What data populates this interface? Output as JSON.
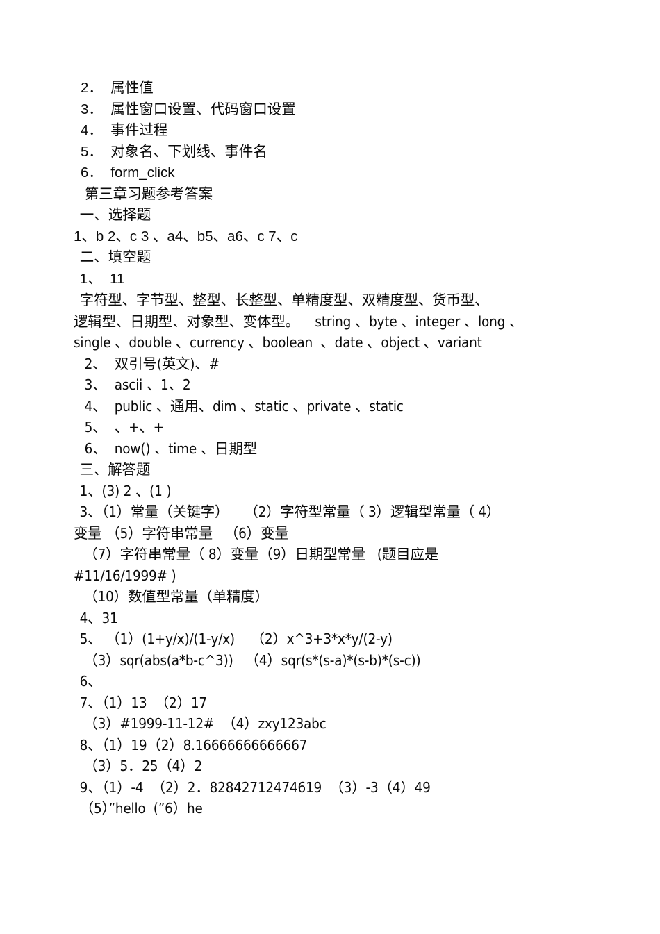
{
  "document": {
    "background_color": "#ffffff",
    "text_color": "#0a0a0a",
    "lines": [
      {
        "id": "l01",
        "text": "2．  属性值"
      },
      {
        "id": "l02",
        "text": "3．  属性窗口设置、代码窗口设置"
      },
      {
        "id": "l03",
        "text": "4．  事件过程"
      },
      {
        "id": "l04",
        "text": "5．  对象名、下划线、事件名"
      },
      {
        "id": "l05",
        "text": "6．  form_click"
      },
      {
        "id": "l06",
        "text": " 第三章习题参考答案"
      },
      {
        "id": "l07",
        "text": " 一、选择题"
      },
      {
        "id": "l08",
        "text": "1、b 2、c 3 、a4、b5、a6、c 7、c"
      },
      {
        "id": "l09",
        "text": " 二、填空题"
      },
      {
        "id": "l10",
        "text": " 1、  11"
      },
      {
        "id": "l11",
        "text": " 字符型、字节型、整型、长整型、单精度型、双精度型、货币型、"
      },
      {
        "id": "l12",
        "text": "逻辑型、日期型、对象型、变体型。    string 、byte 、integer 、long 、"
      },
      {
        "id": "l13",
        "text": "single 、double 、currency 、boolean  、date 、object 、variant"
      },
      {
        "id": "l14",
        "text": " 2、  双引号(英文)、#"
      },
      {
        "id": "l15",
        "text": " 3、  ascii 、1、2"
      },
      {
        "id": "l16",
        "text": " 4、  public 、通用、dim 、static 、private 、static"
      },
      {
        "id": "l17",
        "text": " 5、  、+、+"
      },
      {
        "id": "l18",
        "text": " 6、  now() 、time 、日期型"
      },
      {
        "id": "l19",
        "text": " 三、解答题"
      },
      {
        "id": "l20",
        "text": " 1、(3) 2 、(1 )"
      },
      {
        "id": "l21",
        "text": " 3、（1）常量（关键字）    （2）字符型常量（ 3）逻辑型常量（ 4）"
      },
      {
        "id": "l22",
        "text": "变量 （5）字符串常量   （6）变量"
      },
      {
        "id": "l23",
        "text": "  （7）字符串常量（ 8）变量（9）日期型常量   (题目应是"
      },
      {
        "id": "l24",
        "text": "#11/16/1999# )"
      },
      {
        "id": "l25",
        "text": "  （10）数值型常量（单精度）"
      },
      {
        "id": "l26",
        "text": " 4、31"
      },
      {
        "id": "l27",
        "text": " 5、 （1）(1+y/x)/(1-y/x)    （2）x^3+3*x*y/(2-y)"
      },
      {
        "id": "l28",
        "text": "  （3）sqr(abs(a*b-c^3))   （4）sqr(s*(s-a)*(s-b)*(s-c))"
      },
      {
        "id": "l29",
        "text": " 6、"
      },
      {
        "id": "l30",
        "text": " 7、（1）13  （2）17"
      },
      {
        "id": "l31",
        "text": "  （3）#1999-11-12#  （4）zxy123abc"
      },
      {
        "id": "l32",
        "text": " 8、（1）19（2）8.16666666666667"
      },
      {
        "id": "l33",
        "text": "  （3）5．25（4）2"
      },
      {
        "id": "l34",
        "text": " 9、（1）-4  （2）2．82842712474619  （3）-3（4）49"
      },
      {
        "id": "l35",
        "text": " （5）”hello  (”6）he"
      }
    ]
  }
}
